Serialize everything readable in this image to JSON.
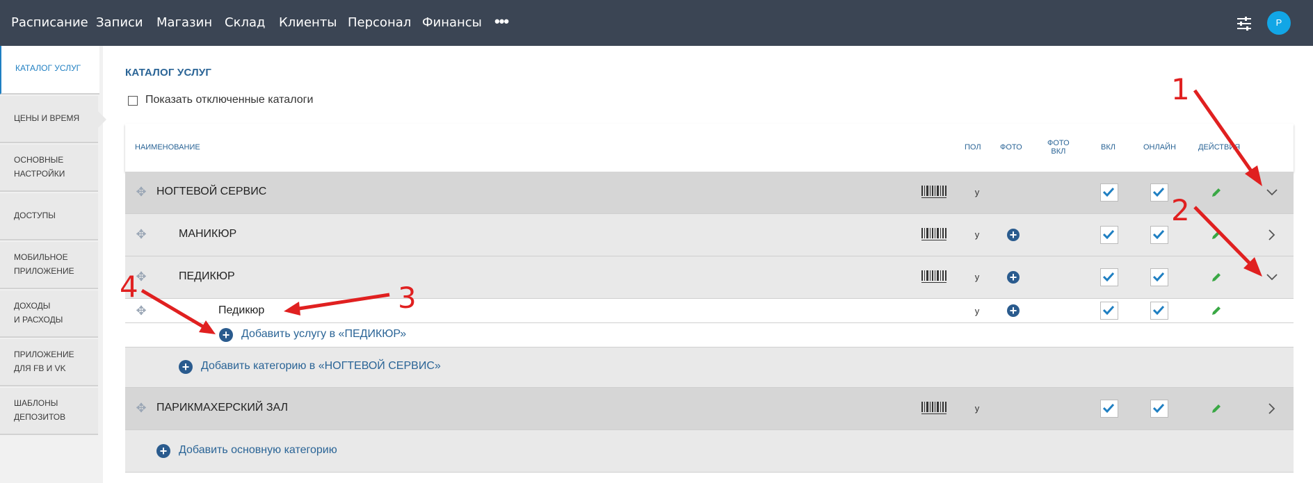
{
  "nav": {
    "items": [
      "Расписание",
      "Записи",
      "Магазин",
      "Склад",
      "Клиенты",
      "Персонал",
      "Финансы"
    ],
    "more": "•••",
    "settings_icon": "sliders-icon",
    "avatar_letter": "P",
    "avatar_color": "#12a6e6",
    "bar_color": "#3b4554"
  },
  "sidebar": {
    "items": [
      {
        "label": "КАТАЛОГ УСЛУГ",
        "active": true
      },
      {
        "label": "ЦЕНЫ И ВРЕМЯ"
      },
      {
        "label": "ОСНОВНЫЕ\nНАСТРОЙКИ"
      },
      {
        "label": "ДОСТУПЫ"
      },
      {
        "label": "МОБИЛЬНОЕ\nПРИЛОЖЕНИЕ"
      },
      {
        "label": "ДОХОДЫ\nИ РАСХОДЫ"
      },
      {
        "label": "ПРИЛОЖЕНИЕ\nДЛЯ FB И VK"
      },
      {
        "label": "ШАБЛОНЫ\nДЕПОЗИТОВ"
      }
    ]
  },
  "main": {
    "title": "КАТАЛОГ УСЛУГ",
    "show_disabled_label": "Показать отключенные каталоги",
    "columns": {
      "name": "НАИМЕНОВАНИЕ",
      "sex": "ПОЛ",
      "photo": "ФОТО",
      "photo_on": "ФОТО\nВКЛ",
      "on": "ВКЛ",
      "online": "ОНЛАЙН",
      "actions": "ДЕЙСТВИЯ"
    },
    "rows": [
      {
        "name": "НОГТЕВОЙ СЕРВИС",
        "sex": "у",
        "on": true,
        "online": true,
        "expanded": true
      },
      {
        "name": "МАНИКЮР",
        "sex": "у",
        "on": true,
        "online": true,
        "expanded": false
      },
      {
        "name": "ПЕДИКЮР",
        "sex": "у",
        "on": true,
        "online": true,
        "expanded": true
      },
      {
        "name": "Педикюр",
        "sex": "у",
        "on": true,
        "online": true
      },
      {
        "name": "ПАРИКМАХЕРСКИЙ ЗАЛ",
        "sex": "у",
        "on": true,
        "online": true,
        "expanded": false
      }
    ],
    "add_service": "Добавить услугу в «ПЕДИКЮР»",
    "add_category": "Добавить категорию в «НОГТЕВОЙ СЕРВИС»",
    "add_main_category": "Добавить основную категорию",
    "accent_color": "#2a6496",
    "check_color": "#1f7fc2",
    "pencil_color": "#3aa845"
  },
  "annotations": {
    "labels": [
      "1",
      "2",
      "3",
      "4"
    ],
    "color": "#e02020"
  }
}
